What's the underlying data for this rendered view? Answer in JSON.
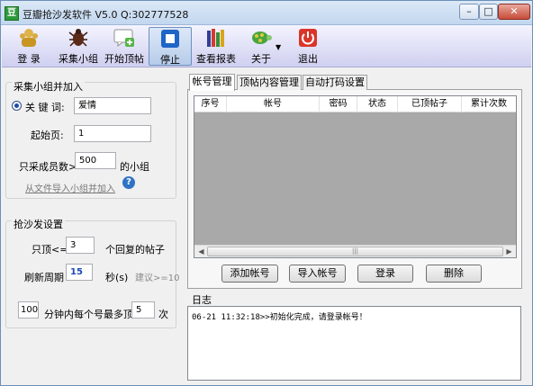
{
  "window": {
    "title": "豆瓣抢沙发软件 V5.0 Q:302777528",
    "app_icon_text": "豆"
  },
  "toolbar": {
    "items": [
      {
        "label": "登 录",
        "icon": "login-users-icon"
      },
      {
        "label": "采集小组",
        "icon": "bug-icon"
      },
      {
        "label": "开始顶帖",
        "icon": "chat-bubble-icon"
      },
      {
        "label": "停止",
        "icon": "stop-icon"
      },
      {
        "label": "查看报表",
        "icon": "books-chart-icon"
      },
      {
        "label": "关于",
        "icon": "turtle-icon"
      },
      {
        "label": "退出",
        "icon": "power-icon"
      }
    ]
  },
  "collect": {
    "title": "采集小组并加入",
    "keyword_label": "关 键 词:",
    "keyword_value": "爱情",
    "start_page_label": "起始页:",
    "start_page_value": "1",
    "members_label": "只采成员数>=",
    "members_value": "500",
    "members_suffix": "的小组",
    "import_link": "从文件导入小组并加入",
    "help_icon": "?"
  },
  "sofa": {
    "title": "抢沙发设置",
    "top_label": "只顶<=",
    "top_value": "3",
    "top_suffix": "个回复的帖子",
    "refresh_label": "刷新周期",
    "refresh_value": "15",
    "refresh_suffix": "秒(s)",
    "refresh_hint": "建议>=10",
    "limit_minutes": "100",
    "limit_middle": "分钟内每个号最多顶",
    "limit_count": "5",
    "limit_suffix": "次"
  },
  "tabs": [
    {
      "label": "帐号管理"
    },
    {
      "label": "顶帖内容管理"
    },
    {
      "label": "自动打码设置"
    }
  ],
  "account_table": {
    "columns": [
      "序号",
      "帐号",
      "密码",
      "状态",
      "已顶帖子",
      "累计次数"
    ]
  },
  "buttons": {
    "add": "添加帐号",
    "import": "导入帐号",
    "login": "登录",
    "delete": "删除"
  },
  "log": {
    "title": "日志",
    "lines": [
      "06-21 11:32:18>>初始化完成，请登录帐号！"
    ]
  }
}
